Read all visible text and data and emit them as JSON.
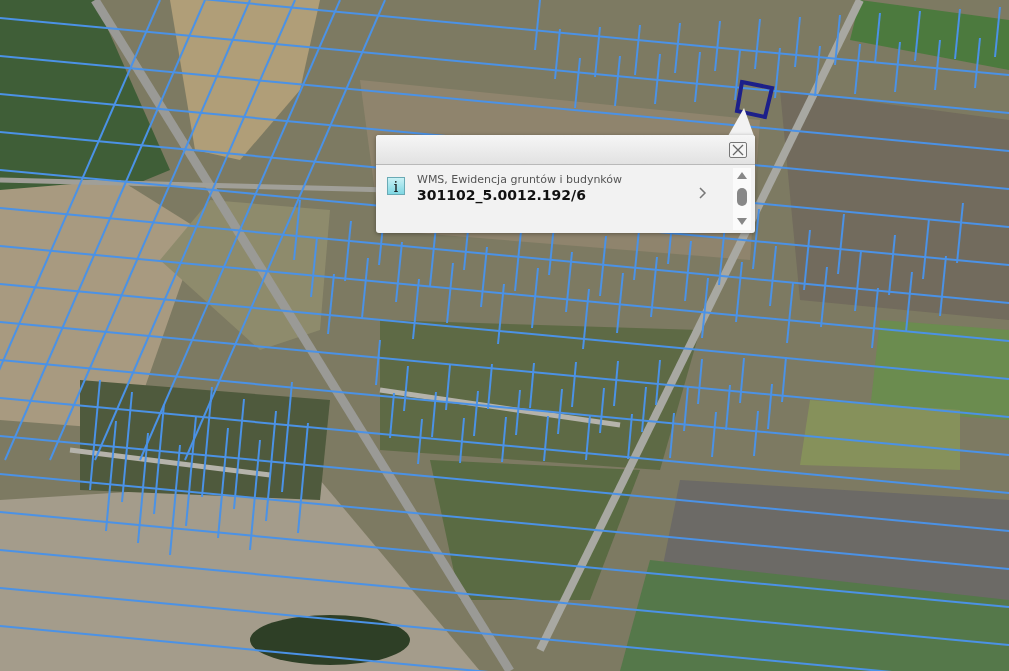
{
  "popup": {
    "info_glyph": "i",
    "layer": "WMS, Ewidencja gruntów i budynków",
    "parcel_id": "301102_5.0012.192/6"
  }
}
